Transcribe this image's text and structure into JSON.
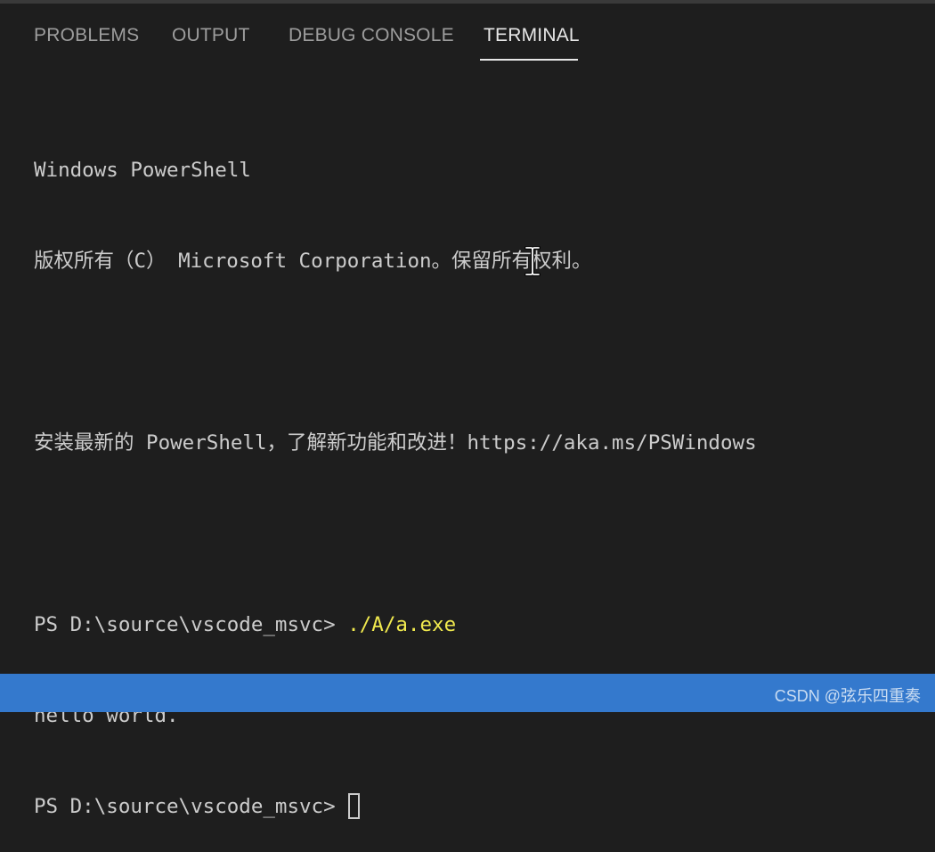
{
  "panel": {
    "tabs": [
      {
        "label": "PROBLEMS",
        "active": false
      },
      {
        "label": "OUTPUT",
        "active": false
      },
      {
        "label": "DEBUG CONSOLE",
        "active": false
      },
      {
        "label": "TERMINAL",
        "active": true
      }
    ]
  },
  "terminal": {
    "lines": [
      "Windows PowerShell",
      "版权所有（C） Microsoft Corporation。保留所有权利。",
      "",
      "安装最新的 PowerShell，了解新功能和改进！https://aka.ms/PSWindows",
      ""
    ],
    "prompt": "PS D:\\source\\vscode_msvc> ",
    "command": "./A/a.exe",
    "output": "hello world.",
    "prompt2": "PS D:\\source\\vscode_msvc>"
  },
  "status_bar": {
    "watermark": "CSDN @弦乐四重奏"
  },
  "colors": {
    "background": "#1e1e1e",
    "tab_inactive": "#9d9d9d",
    "tab_active": "#e7e7e7",
    "terminal_text": "#cccccc",
    "command": "#f0e94e",
    "status_bar": "#3479cd"
  },
  "icons": {
    "mouse_pointer": "text-cursor-ibeam-icon",
    "terminal_cursor": "block-cursor-icon"
  }
}
